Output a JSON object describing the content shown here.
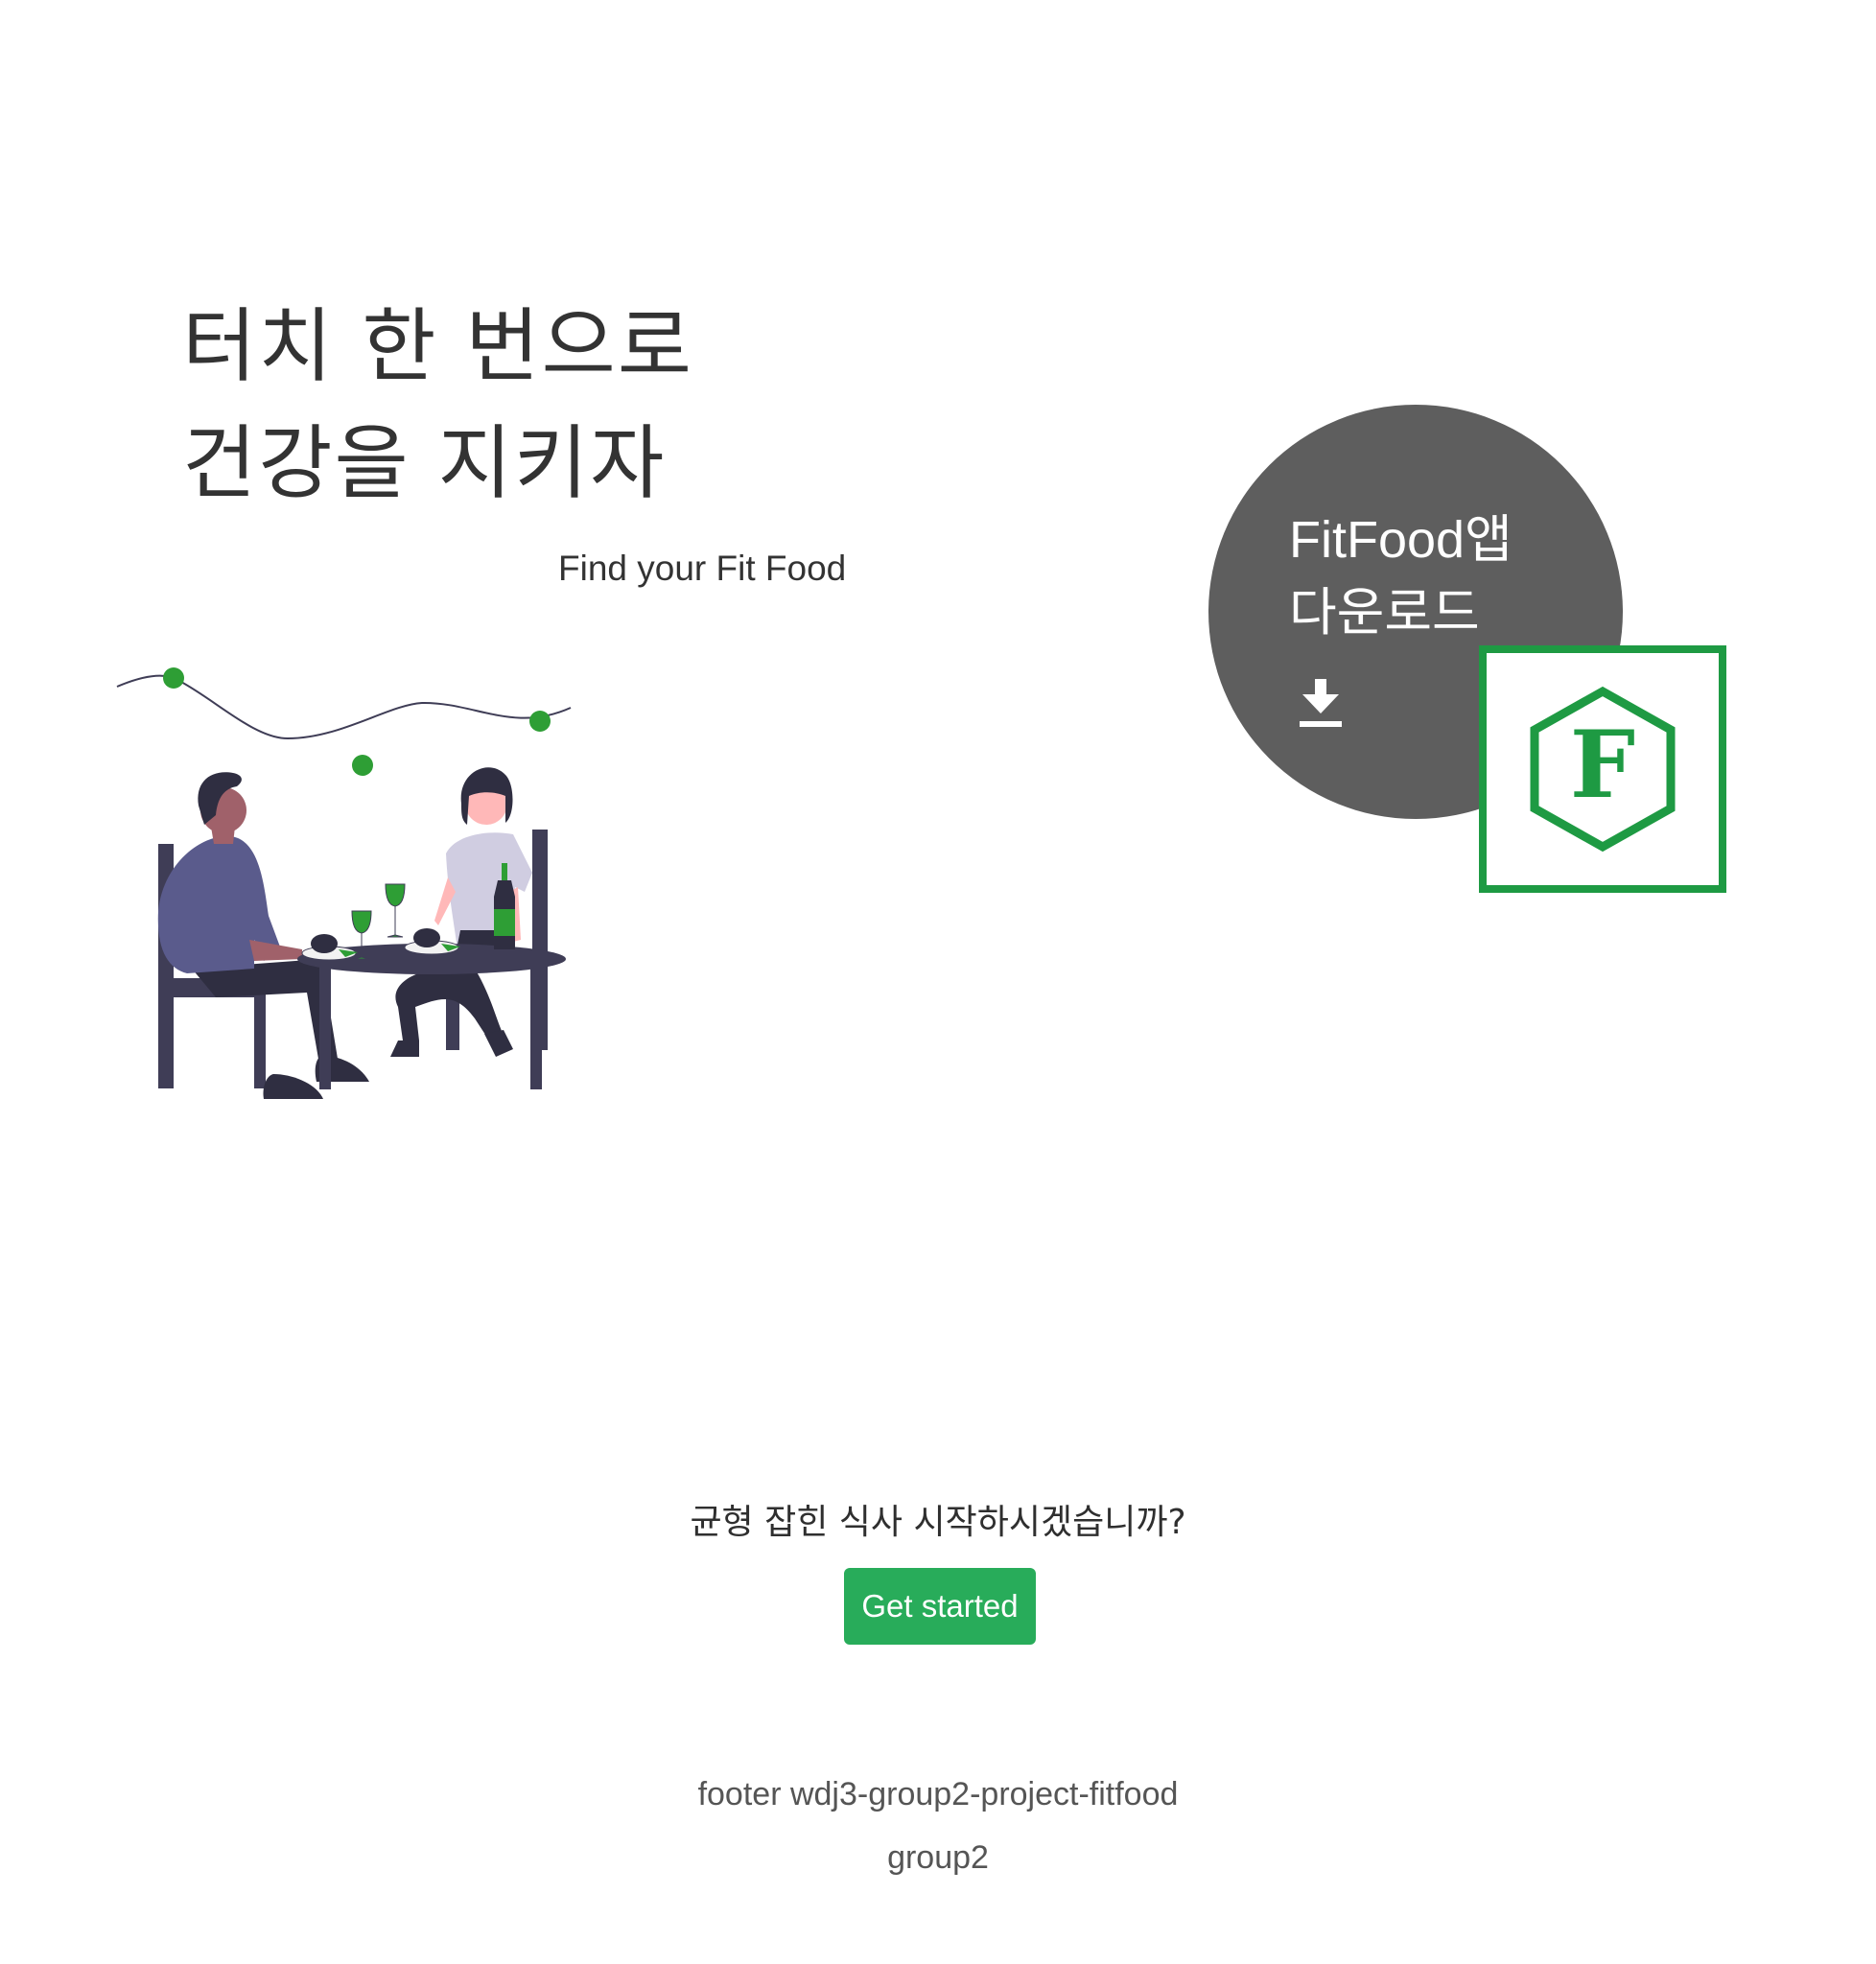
{
  "hero": {
    "title_line1": "터치 한 번으로",
    "title_line2": "건강을 지키자",
    "subtitle": "Find your Fit Food"
  },
  "download": {
    "title_line1": "FitFood앱",
    "title_line2": "다운로드",
    "icon": "download-icon",
    "logo_letter": "F"
  },
  "cta": {
    "question": "균형 잡힌 식사 시작하시겠습니까?",
    "button_label": "Get started"
  },
  "footer": {
    "line1": "footer wdj3-group2-project-fitfood",
    "line2": "group2"
  },
  "colors": {
    "accent_green": "#28ac5a",
    "logo_green": "#1e9a43",
    "circle_gray": "#5e5e5e",
    "illustration_purple": "#5a5b8c",
    "illustration_dark": "#3f3d56"
  }
}
